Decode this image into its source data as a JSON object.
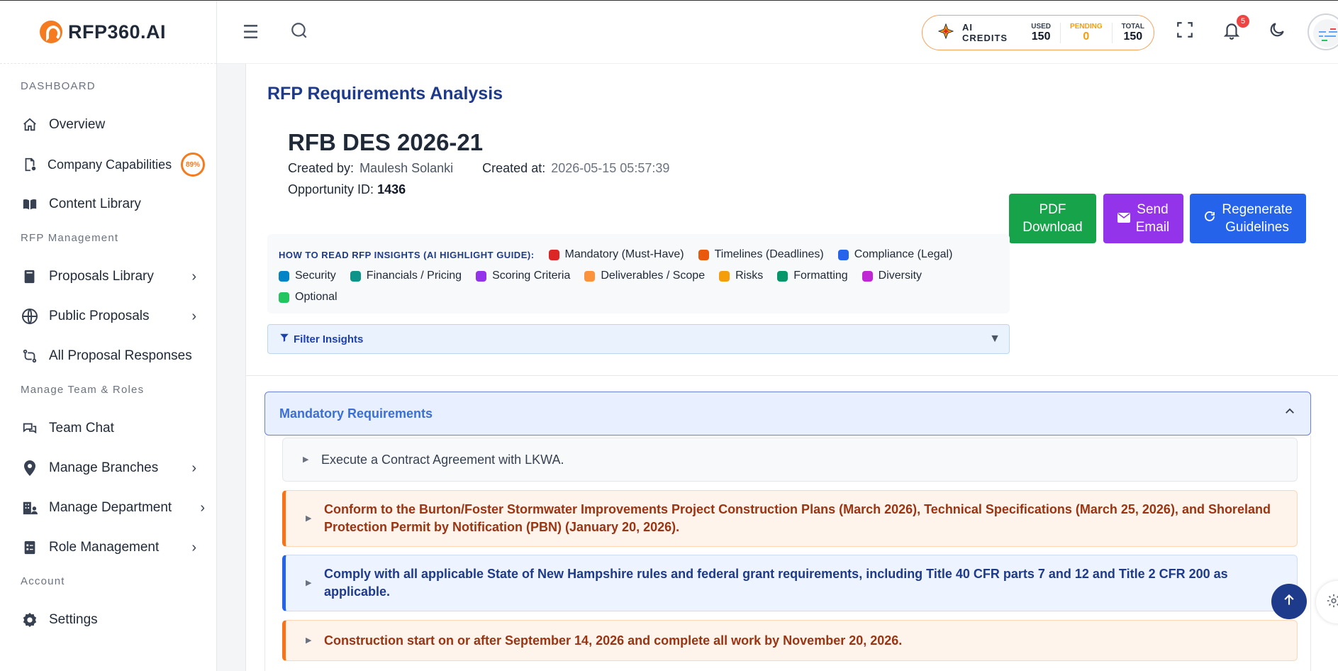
{
  "brand": {
    "name": "RFP360.AI"
  },
  "sidebar": {
    "sections": [
      {
        "title": "DASHBOARD"
      },
      {
        "title": "RFP Management"
      },
      {
        "title": "Manage Team & Roles"
      },
      {
        "title": "Account"
      }
    ],
    "items": [
      {
        "label": "Overview",
        "icon": "home-icon"
      },
      {
        "label": "Company Capabilities",
        "icon": "file-cog-icon",
        "badge": "89%"
      },
      {
        "label": "Content Library",
        "icon": "book-open-icon"
      },
      {
        "label": "Proposals Library",
        "icon": "book-icon"
      },
      {
        "label": "Public Proposals",
        "icon": "globe-icon"
      },
      {
        "label": "All Proposal Responses",
        "icon": "git-compare-icon"
      },
      {
        "label": "Team Chat",
        "icon": "chat-icon"
      },
      {
        "label": "Manage Branches",
        "icon": "map-pin-icon"
      },
      {
        "label": "Manage Department",
        "icon": "building-icon"
      },
      {
        "label": "Role Management",
        "icon": "clipboard-icon"
      },
      {
        "label": "Settings",
        "icon": "gear-icon"
      }
    ]
  },
  "header": {
    "credits": {
      "title": "AI CREDITS",
      "used_label": "USED",
      "used": "150",
      "pending_label": "PENDING",
      "pending": "0",
      "total_label": "TOTAL",
      "total": "150"
    },
    "notifications_count": "5"
  },
  "main": {
    "page_title": "RFP Requirements Analysis",
    "rfb_title": "RFB DES 2026-21",
    "created_by_label": "Created by:",
    "created_by": "Maulesh Solanki",
    "created_at_label": "Created at:",
    "created_at": "2026-05-15 05:57:39",
    "opportunity_label": "Opportunity ID:",
    "opportunity_id": "1436",
    "buttons": {
      "pdf_line1": "PDF",
      "pdf_line2": "Download",
      "email_line1": "Send",
      "email_line2": "Email",
      "regen_line1": "Regenerate",
      "regen_line2": "Guidelines"
    },
    "guide": {
      "title": "HOW TO READ RFP INSIGHTS (AI HIGHLIGHT GUIDE):",
      "legend": [
        {
          "label": "Mandatory (Must-Have)",
          "color": "#dc2626"
        },
        {
          "label": "Timelines (Deadlines)",
          "color": "#ea580c"
        },
        {
          "label": "Compliance (Legal)",
          "color": "#2563eb"
        },
        {
          "label": "Security",
          "color": "#0284c7"
        },
        {
          "label": "Financials / Pricing",
          "color": "#0d9488"
        },
        {
          "label": "Scoring Criteria",
          "color": "#9333ea"
        },
        {
          "label": "Deliverables / Scope",
          "color": "#fb923c"
        },
        {
          "label": "Risks",
          "color": "#f59e0b"
        },
        {
          "label": "Formatting",
          "color": "#059669"
        },
        {
          "label": "Diversity",
          "color": "#c026d3"
        },
        {
          "label": "Optional",
          "color": "#22c55e"
        }
      ]
    },
    "filter_label": "Filter Insights",
    "accordion_title": "Mandatory Requirements",
    "requirements": [
      "Execute a Contract Agreement with LKWA.",
      "Conform to the Burton/Foster Stormwater Improvements Project Construction Plans (March 2026), Technical Specifications (March 25, 2026), and Shoreland Protection Permit by Notification (PBN) (January 20, 2026).",
      "Comply with all applicable State of New Hampshire rules and federal grant requirements, including Title 40 CFR parts 7 and 12 and Title 2 CFR 200 as applicable.",
      "Construction start on or after September 14, 2026 and complete all work by November 20, 2026."
    ]
  }
}
